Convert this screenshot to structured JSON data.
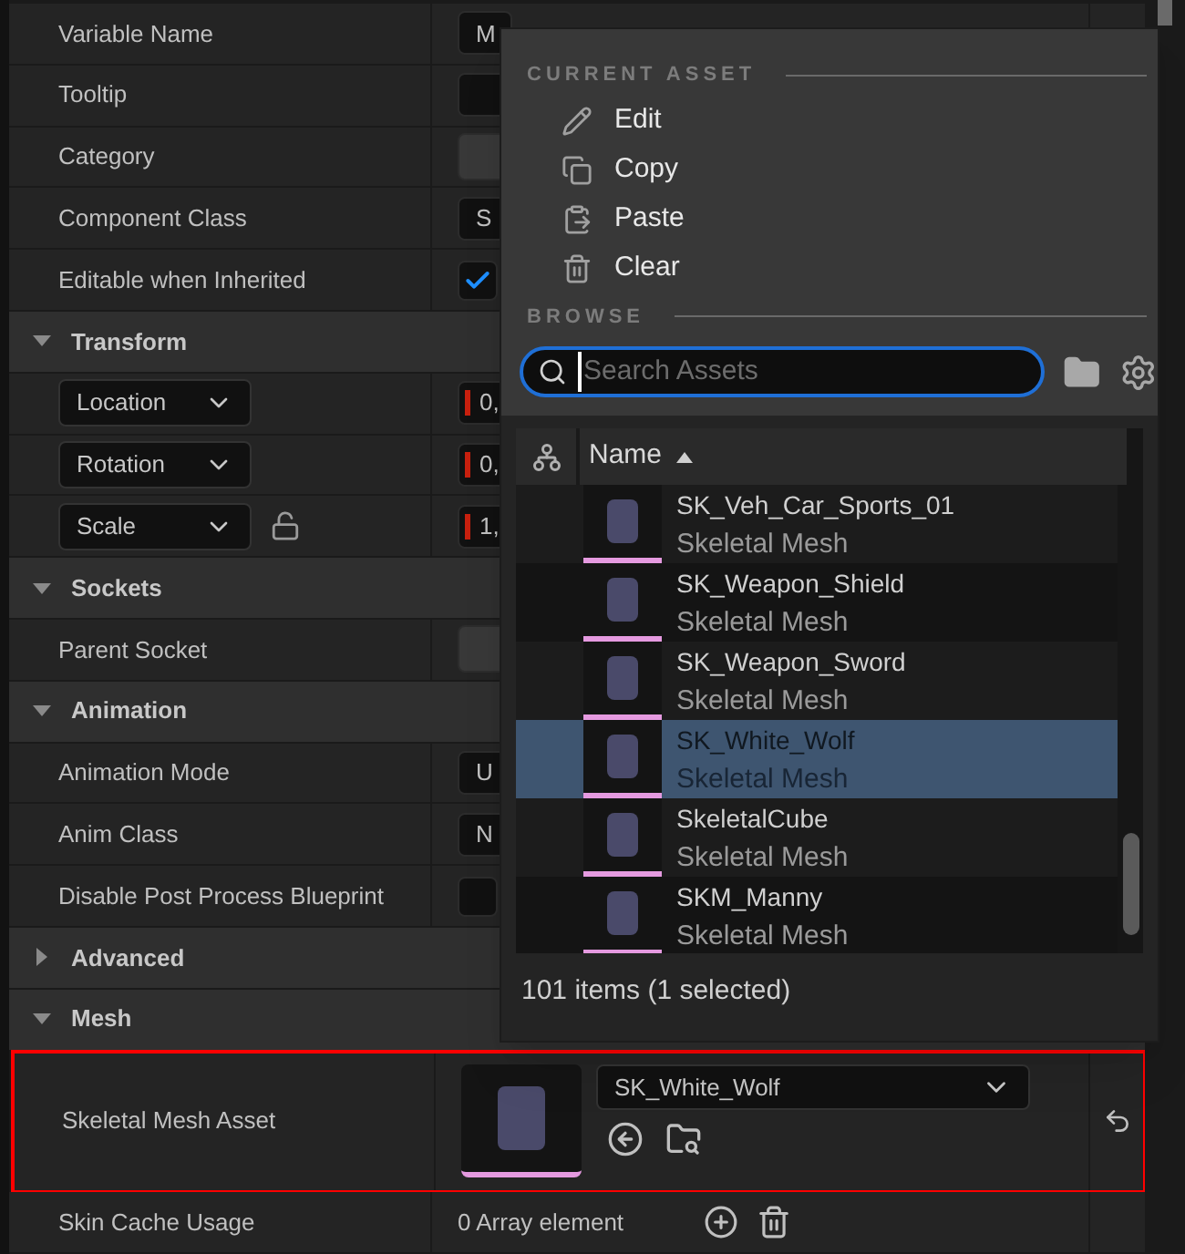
{
  "details": {
    "rows": [
      {
        "kind": "field",
        "label": "Variable Name",
        "value": "M"
      },
      {
        "kind": "field",
        "label": "Tooltip"
      },
      {
        "kind": "combo",
        "label": "Category"
      },
      {
        "kind": "field",
        "label": "Component Class",
        "value": "S"
      },
      {
        "kind": "checkbox",
        "label": "Editable when Inherited",
        "checked": true
      },
      {
        "kind": "header",
        "label": "Transform",
        "expanded": true
      },
      {
        "kind": "vector",
        "label": "Location",
        "value": "0,"
      },
      {
        "kind": "vector",
        "label": "Rotation",
        "value": "0,"
      },
      {
        "kind": "vector-lock",
        "label": "Scale",
        "value": "1,"
      },
      {
        "kind": "header",
        "label": "Sockets",
        "expanded": true
      },
      {
        "kind": "combo",
        "label": "Parent Socket"
      },
      {
        "kind": "header",
        "label": "Animation",
        "expanded": true
      },
      {
        "kind": "field",
        "label": "Animation Mode",
        "value": "U"
      },
      {
        "kind": "field",
        "label": "Anim Class",
        "value": "N"
      },
      {
        "kind": "checkbox",
        "label": "Disable Post Process Blueprint",
        "checked": false
      },
      {
        "kind": "header",
        "label": "Advanced",
        "expanded": false
      },
      {
        "kind": "header",
        "label": "Mesh",
        "expanded": true
      },
      {
        "kind": "asset",
        "label": "Skeletal Mesh Asset",
        "value": "SK_White_Wolf",
        "highlighted": true
      },
      {
        "kind": "array",
        "label": "Skin Cache Usage",
        "value": "0 Array element"
      }
    ]
  },
  "asset_picker": {
    "current_asset_title": "CURRENT ASSET",
    "actions": [
      {
        "kind": "edit",
        "label": "Edit"
      },
      {
        "kind": "copy",
        "label": "Copy"
      },
      {
        "kind": "paste",
        "label": "Paste"
      },
      {
        "kind": "clear",
        "label": "Clear"
      }
    ],
    "browse_title": "BROWSE",
    "search": {
      "placeholder": "Search Assets"
    },
    "column": "Name",
    "assets": [
      {
        "name": "SK_Veh_Car_Sports_01",
        "type": "Skeletal Mesh",
        "selected": false
      },
      {
        "name": "SK_Weapon_Shield",
        "type": "Skeletal Mesh",
        "selected": false
      },
      {
        "name": "SK_Weapon_Sword",
        "type": "Skeletal Mesh",
        "selected": false
      },
      {
        "name": "SK_White_Wolf",
        "type": "Skeletal Mesh",
        "selected": true
      },
      {
        "name": "SkeletalCube",
        "type": "Skeletal Mesh",
        "selected": false
      },
      {
        "name": "SKM_Manny",
        "type": "Skeletal Mesh",
        "selected": false
      }
    ],
    "status": "101 items (1 selected)"
  }
}
